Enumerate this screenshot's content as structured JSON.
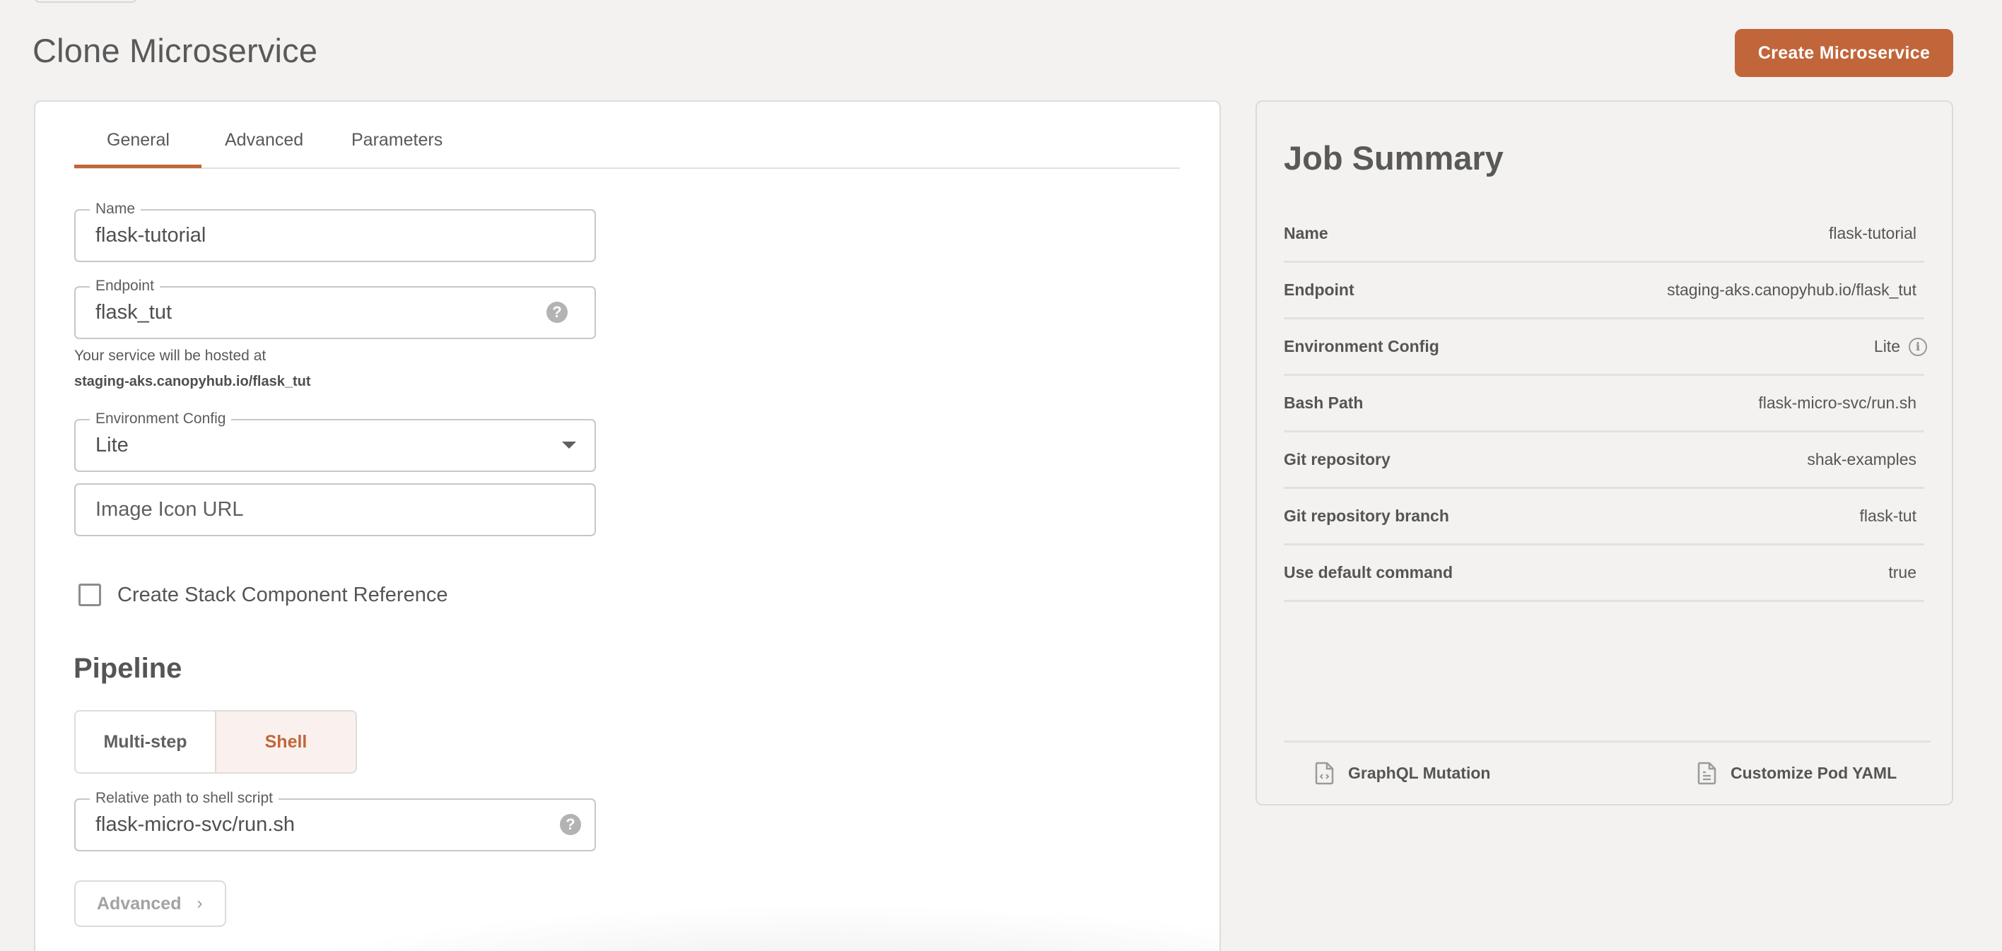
{
  "page": {
    "title": "Clone Microservice",
    "create_button": "Create Microservice"
  },
  "tabs": [
    {
      "label": "General",
      "active": true
    },
    {
      "label": "Advanced",
      "active": false
    },
    {
      "label": "Parameters",
      "active": false
    }
  ],
  "form": {
    "name": {
      "label": "Name",
      "value": "flask-tutorial"
    },
    "endpoint": {
      "label": "Endpoint",
      "value": "flask_tut",
      "help_icon": "question-circle-icon"
    },
    "host_help": {
      "line1": "Your service will be hosted at",
      "line2": "staging-aks.canopyhub.io/flask_tut"
    },
    "environment_config": {
      "label": "Environment Config",
      "value": "Lite",
      "icon": "chevron-down-icon"
    },
    "image_icon_url": {
      "placeholder": "Image Icon URL",
      "value": ""
    },
    "stack_component_reference": {
      "label": "Create Stack Component Reference",
      "checked": false
    },
    "pipeline": {
      "heading": "Pipeline",
      "options": [
        {
          "label": "Multi-step",
          "selected": false
        },
        {
          "label": "Shell",
          "selected": true
        }
      ]
    },
    "relative_path": {
      "label": "Relative path to shell script",
      "value": "flask-micro-svc/run.sh",
      "help_icon": "question-circle-icon"
    },
    "advanced_button": {
      "label": "Advanced",
      "icon": "chevron-right-icon"
    }
  },
  "summary": {
    "title": "Job Summary",
    "rows": [
      {
        "key": "Name",
        "value": "flask-tutorial"
      },
      {
        "key": "Endpoint",
        "value": "staging-aks.canopyhub.io/flask_tut"
      },
      {
        "key": "Environment Config",
        "value": "Lite",
        "icon": "info-icon"
      },
      {
        "key": "Bash Path",
        "value": "flask-micro-svc/run.sh"
      },
      {
        "key": "Git repository",
        "value": "shak-examples"
      },
      {
        "key": "Git repository branch",
        "value": "flask-tut"
      },
      {
        "key": "Use default command",
        "value": "true"
      }
    ],
    "footer": {
      "graphql": {
        "label": "GraphQL Mutation",
        "icon": "code-file-icon"
      },
      "yaml": {
        "label": "Customize Pod YAML",
        "icon": "document-icon"
      }
    }
  },
  "colors": {
    "accent": "#c1663a",
    "accent_bg": "#faf1ee",
    "page_bg": "#f3f2f1"
  }
}
